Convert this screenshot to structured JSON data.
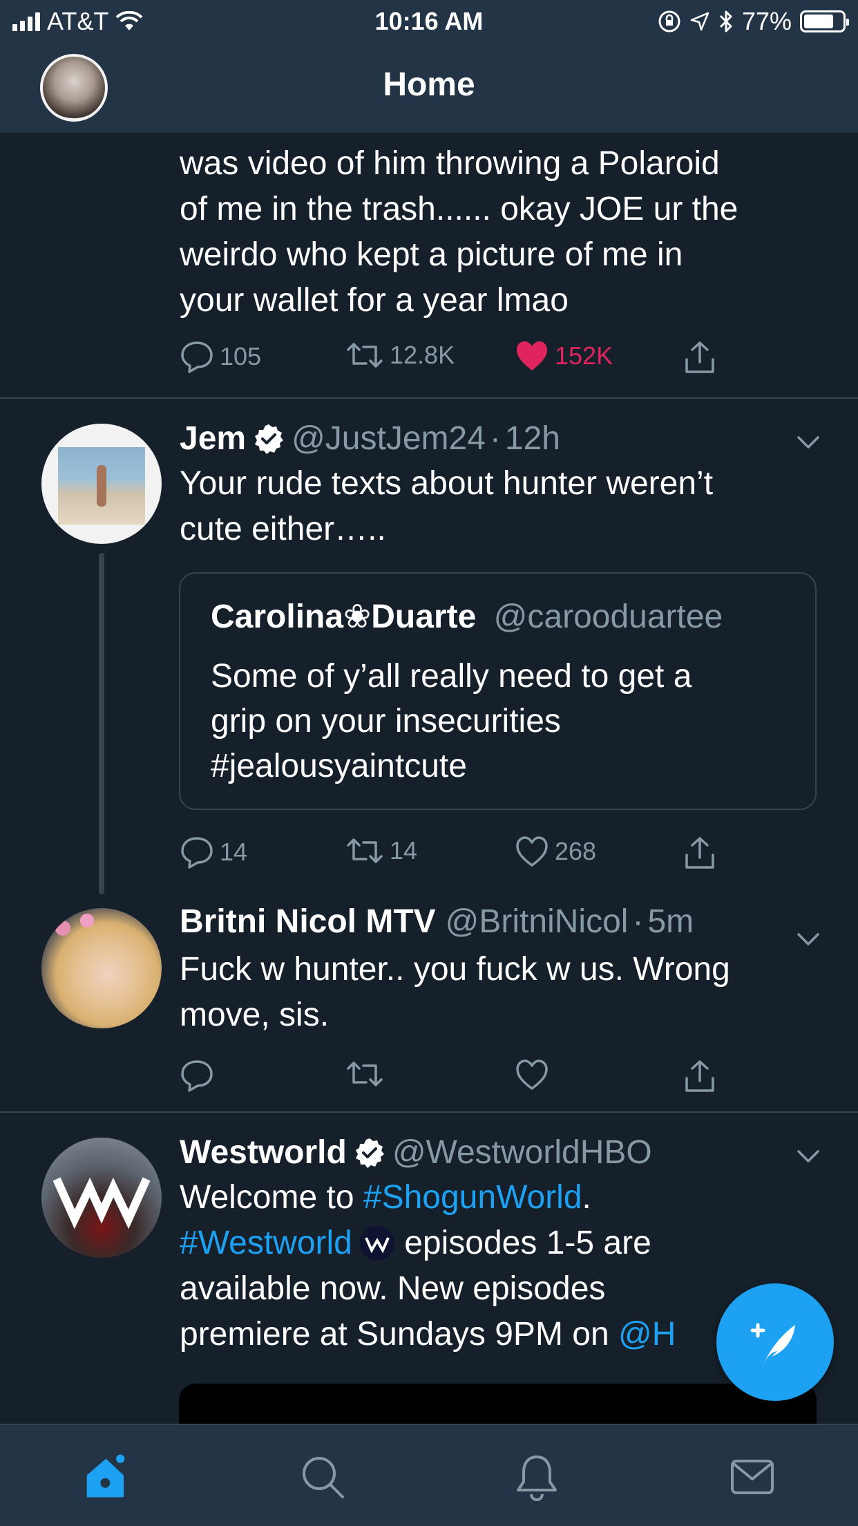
{
  "status_bar": {
    "carrier": "AT&T",
    "time": "10:16 AM",
    "battery": "77%"
  },
  "header": {
    "title": "Home"
  },
  "tweets": [
    {
      "text_lines": [
        "was video of him throwing a Polaroid",
        "of me in the trash...... okay JOE ur the",
        "weirdo who kept a picture of me in",
        "your wallet for a year lmao"
      ],
      "replies": "105",
      "retweets": "12.8K",
      "likes": "152K"
    },
    {
      "name": "Jem",
      "handle": "@JustJem24",
      "sep": "·",
      "time": "12h",
      "text_lines": [
        "Your rude texts about hunter weren’t",
        "cute either….."
      ],
      "quote": {
        "name": "Carolina❀Duarte",
        "handle": "@carooduartee",
        "text_lines": [
          "Some of y’all really need to get a",
          "grip on your insecurities",
          "#jealousyaintcute"
        ]
      },
      "replies": "14",
      "retweets": "14",
      "likes": "268"
    },
    {
      "name": "Britni Nicol MTV",
      "handle": "@BritniNicol",
      "sep": "·",
      "time": "5m",
      "text_lines": [
        "Fuck w hunter.. you fuck w us. Wrong",
        "move, sis."
      ]
    },
    {
      "name": "Westworld",
      "handle": "@WestworldHBO",
      "line1_a": "Welcome to ",
      "line1_link": "#ShogunWorld",
      "line1_b": ".",
      "line2_link": "#Westworld",
      "line2_rest": " episodes 1-5 are",
      "line3": "available now. New episodes",
      "line4_a": "premiere at Sundays 9PM on ",
      "line4_link": "@H"
    }
  ],
  "colors": {
    "background": "#15202b",
    "bars": "#243447",
    "accent": "#1da1f2",
    "like_active": "#e0245e"
  },
  "icons": [
    "reply-icon",
    "retweet-icon",
    "like-icon",
    "share-icon",
    "home-icon",
    "search-icon",
    "notifications-icon",
    "messages-icon",
    "compose-icon",
    "verified-icon",
    "chevron-down-icon"
  ]
}
